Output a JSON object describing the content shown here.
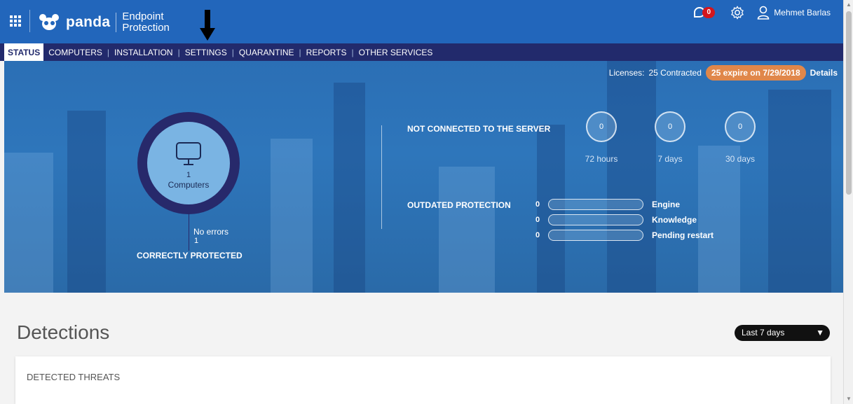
{
  "header": {
    "product_line1": "Endpoint",
    "product_line2": "Protection",
    "logo_text": "panda",
    "notification_count": "0",
    "user_name": "Mehmet Barlas"
  },
  "nav": {
    "items": [
      "STATUS",
      "COMPUTERS",
      "INSTALLATION",
      "SETTINGS",
      "QUARANTINE",
      "REPORTS",
      "OTHER SERVICES"
    ],
    "active": "STATUS"
  },
  "licenses": {
    "label": "Licenses:",
    "contracted": "25 Contracted",
    "expire": "25 expire on 7/29/2018",
    "details": "Details"
  },
  "protection": {
    "computer_count": "1",
    "computer_label": "Computers",
    "no_errors_label": "No errors",
    "no_errors_count": "1",
    "status_label": "CORRECTLY PROTECTED"
  },
  "not_connected": {
    "title": "NOT CONNECTED TO THE SERVER",
    "items": [
      {
        "value": "0",
        "label": "72 hours"
      },
      {
        "value": "0",
        "label": "7 days"
      },
      {
        "value": "0",
        "label": "30 days"
      }
    ]
  },
  "outdated": {
    "title": "OUTDATED PROTECTION",
    "items": [
      {
        "count": "0",
        "label": "Engine"
      },
      {
        "count": "0",
        "label": "Knowledge"
      },
      {
        "count": "0",
        "label": "Pending restart"
      }
    ]
  },
  "detections": {
    "title": "Detections",
    "range": "Last 7 days",
    "card_title": "DETECTED THREATS"
  },
  "colors": {
    "header_blue": "#2266bb",
    "nav_navy": "#222a6c",
    "license_orange": "#e0874a",
    "badge_red": "#d3161e"
  }
}
